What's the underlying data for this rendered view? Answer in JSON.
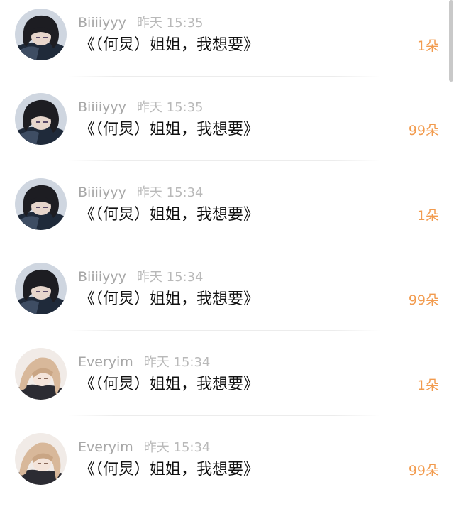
{
  "comments": [
    {
      "username": "Biiiiyyy",
      "time": "昨天 15:35",
      "text": "《（何炅）姐姐，我想要》",
      "gift": "1朵",
      "avatar": "dark-hair-avatar"
    },
    {
      "username": "Biiiiyyy",
      "time": "昨天 15:35",
      "text": "《（何炅）姐姐，我想要》",
      "gift": "99朵",
      "avatar": "dark-hair-avatar"
    },
    {
      "username": "Biiiiyyy",
      "time": "昨天 15:34",
      "text": "《（何炅）姐姐，我想要》",
      "gift": "1朵",
      "avatar": "dark-hair-avatar"
    },
    {
      "username": "Biiiiyyy",
      "time": "昨天 15:34",
      "text": "《（何炅）姐姐，我想要》",
      "gift": "99朵",
      "avatar": "dark-hair-avatar"
    },
    {
      "username": "Everyim",
      "time": "昨天 15:34",
      "text": "《（何炅）姐姐，我想要》",
      "gift": "1朵",
      "avatar": "light-hair-avatar"
    },
    {
      "username": "Everyim",
      "time": "昨天 15:34",
      "text": "《（何炅）姐姐，我想要》",
      "gift": "99朵",
      "avatar": "light-hair-avatar"
    }
  ],
  "colors": {
    "username": "#a7a7a7",
    "timestamp": "#b9b9b9",
    "message": "#111111",
    "gift": "#f29b4e",
    "divider": "#ececec"
  }
}
